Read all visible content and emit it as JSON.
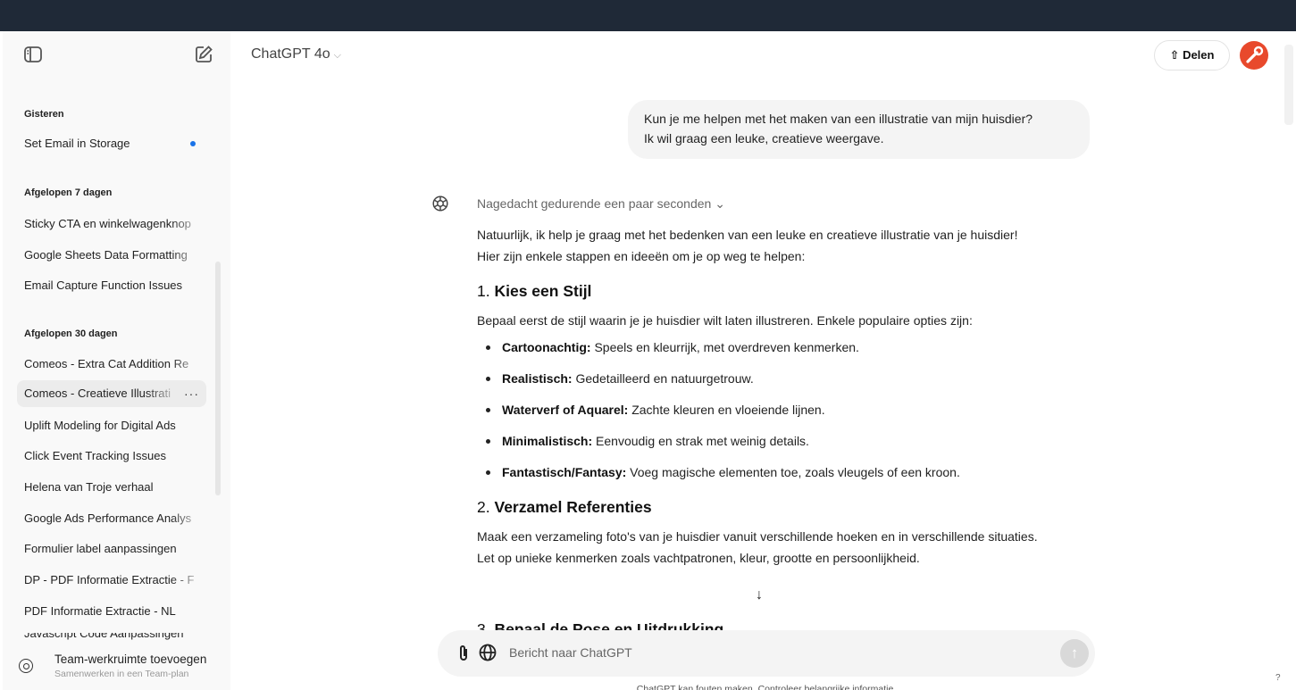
{
  "header": {
    "model": "ChatGPT 4o",
    "share_label": "Delen"
  },
  "sidebar": {
    "groups": [
      {
        "title": "Gisteren",
        "items": [
          "Set Email in Storage"
        ]
      },
      {
        "title": "Afgelopen 7 dagen",
        "items": [
          "Sticky CTA en winkelwagenknop",
          "Google Sheets Data Formatting",
          "Email Capture Function Issues"
        ]
      },
      {
        "title": "Afgelopen 30 dagen",
        "items": [
          "Comeos - Extra Cat Addition Re",
          "Comeos - Creatieve Illustrati",
          "Uplift Modeling for Digital Ads",
          "Click Event Tracking Issues",
          "Helena van Troje verhaal",
          "Google Ads Performance Analys",
          "Formulier label aanpassingen",
          "DP - PDF Informatie Extractie - F",
          "PDF Informatie Extractie - NL",
          "Javascript Code Aanpassingen"
        ]
      }
    ],
    "more_label": "···",
    "team_title": "Team-werkruimte toevoegen",
    "team_subtitle": "Samenwerken in een Team-plan"
  },
  "chat": {
    "user_message": [
      "Kun je me helpen met het maken van een illustratie van mijn huisdier?",
      "Ik wil graag een leuke, creatieve weergave."
    ],
    "thought_label": "Nagedacht gedurende een paar seconden",
    "intro": [
      "Natuurlijk, ik help je graag met het bedenken van een leuke en creatieve illustratie van je huisdier!",
      "Hier zijn enkele stappen en ideeën om je op weg te helpen:"
    ],
    "sections": [
      {
        "number": "1.",
        "title": "Kies een Stijl",
        "text": "Bepaal eerst de stijl waarin je je huisdier wilt laten illustreren. Enkele populaire opties zijn:",
        "bullets": [
          {
            "term": "Cartoonachtig:",
            "text": " Speels en kleurrijk, met overdreven kenmerken."
          },
          {
            "term": "Realistisch:",
            "text": " Gedetailleerd en natuurgetrouw."
          },
          {
            "term": "Waterverf of Aquarel:",
            "text": " Zachte kleuren en vloeiende lijnen."
          },
          {
            "term": "Minimalistisch:",
            "text": " Eenvoudig en strak met weinig details."
          },
          {
            "term": "Fantastisch/Fantasy:",
            "text": " Voeg magische elementen toe, zoals vleugels of een kroon."
          }
        ]
      },
      {
        "number": "2.",
        "title": "Verzamel Referenties",
        "lines": [
          "Maak een verzameling foto's van je huisdier vanuit verschillende hoeken en in verschillende situaties.",
          "Let op unieke kenmerken zoals vachtpatronen, kleur, grootte en persoonlijkheid."
        ]
      },
      {
        "number": "3.",
        "title": "Bepaal de Pose en Uitdrukking"
      }
    ]
  },
  "composer": {
    "placeholder": "Bericht naar ChatGPT",
    "disclaimer": "ChatGPT kan fouten maken. Controleer belangrijke informatie."
  },
  "misc": {
    "help": "?"
  },
  "colors": {
    "accent_dot": "#1a73e8",
    "avatar": "#e8492c",
    "sidebar_bg": "#f9f9f9"
  }
}
